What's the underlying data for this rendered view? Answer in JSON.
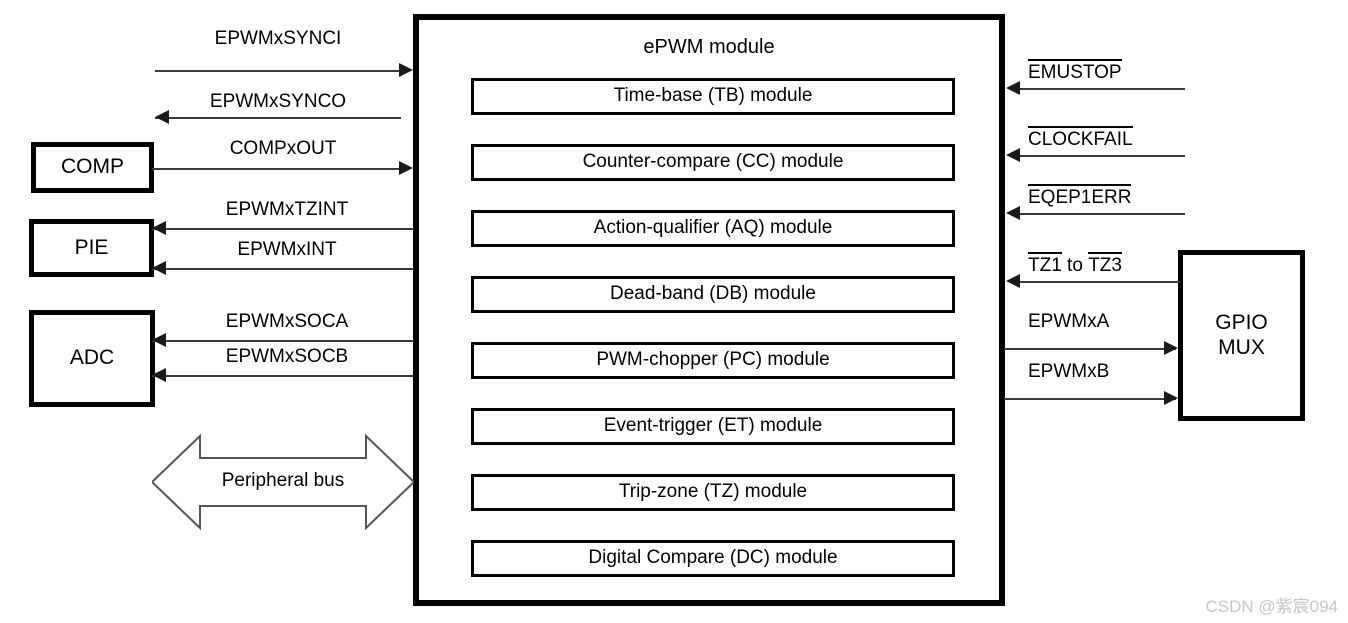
{
  "diagram": {
    "title": "ePWM module",
    "watermark": "CSDN @紫宸094",
    "accent_color": "#000000",
    "line_color": "#3a3a3a",
    "background": "#ffffff"
  },
  "epwm": {
    "title": "ePWM module",
    "submodules": [
      {
        "label": "Time-base (TB) module",
        "abbrev": "TB"
      },
      {
        "label": "Counter-compare (CC) module",
        "abbrev": "CC"
      },
      {
        "label": "Action-qualifier (AQ) module",
        "abbrev": "AQ"
      },
      {
        "label": "Dead-band (DB) module",
        "abbrev": "DB"
      },
      {
        "label": "PWM-chopper (PC) module",
        "abbrev": "PC"
      },
      {
        "label": "Event-trigger (ET) module",
        "abbrev": "ET"
      },
      {
        "label": "Trip-zone (TZ) module",
        "abbrev": "TZ"
      },
      {
        "label": "Digital Compare (DC) module",
        "abbrev": "DC"
      }
    ]
  },
  "peripheral_blocks": [
    {
      "name": "comp",
      "label": "COMP",
      "side": "left"
    },
    {
      "name": "pie",
      "label": "PIE",
      "side": "left"
    },
    {
      "name": "adc",
      "label": "ADC",
      "side": "left"
    },
    {
      "name": "gpio_mux",
      "label": "GPIO\nMUX",
      "side": "right"
    }
  ],
  "signals_left": [
    {
      "label": "EPWMxSYNCI",
      "direction": "into-module",
      "overbar": false,
      "from": "external"
    },
    {
      "label": "EPWMxSYNCO",
      "direction": "out-of-module",
      "overbar": false,
      "to": "external"
    },
    {
      "label": "COMPxOUT",
      "direction": "into-module",
      "overbar": false,
      "from": "COMP"
    },
    {
      "label": "EPWMxTZINT",
      "direction": "out-of-module",
      "overbar": false,
      "to": "PIE"
    },
    {
      "label": "EPWMxINT",
      "direction": "out-of-module",
      "overbar": false,
      "to": "PIE"
    },
    {
      "label": "EPWMxSOCA",
      "direction": "out-of-module",
      "overbar": false,
      "to": "ADC"
    },
    {
      "label": "EPWMxSOCB",
      "direction": "out-of-module",
      "overbar": false,
      "to": "ADC"
    }
  ],
  "signals_right": [
    {
      "label": "EMUSTOP",
      "direction": "into-module",
      "overbar": true,
      "overbar_span": "all"
    },
    {
      "label": "CLOCKFAIL",
      "direction": "into-module",
      "overbar": true,
      "overbar_span": "all"
    },
    {
      "label": "EQEP1ERR",
      "direction": "into-module",
      "overbar": true,
      "overbar_span": "all"
    },
    {
      "label": "TZ1 to TZ3",
      "direction": "into-module",
      "overbar": true,
      "overbar_span": "partial",
      "parts": [
        {
          "text": "TZ1",
          "overbar": true
        },
        {
          "text": " to ",
          "overbar": false
        },
        {
          "text": "TZ3",
          "overbar": true
        }
      ],
      "from": "GPIO MUX"
    },
    {
      "label": "EPWMxA",
      "direction": "out-of-module",
      "overbar": false,
      "to": "GPIO MUX"
    },
    {
      "label": "EPWMxB",
      "direction": "out-of-module",
      "overbar": false,
      "to": "GPIO MUX"
    }
  ],
  "bus": {
    "label": "Peripheral bus",
    "style": "hollow-double-headed-arrow",
    "direction": "bidirectional"
  }
}
